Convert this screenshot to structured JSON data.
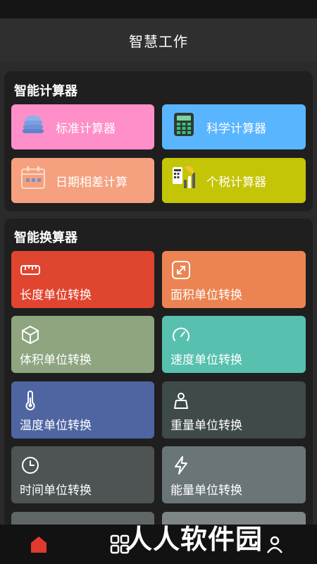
{
  "header": {
    "title": "智慧工作"
  },
  "calculators": {
    "title": "智能计算器",
    "items": [
      {
        "label": "标准计算器",
        "icon": "coin-stack-icon",
        "color": "#ff8fc8"
      },
      {
        "label": "科学计算器",
        "icon": "calculator-icon",
        "color": "#5ab5ff"
      },
      {
        "label": "日期相差计算",
        "icon": "calendar-icon",
        "color": "#f5a07f"
      },
      {
        "label": "个税计算器",
        "icon": "tax-chart-icon",
        "color": "#c4c507"
      }
    ]
  },
  "converters": {
    "title": "智能换算器",
    "items": [
      {
        "label": "长度单位转换",
        "icon": "ruler-icon",
        "color": "#e04530"
      },
      {
        "label": "面积单位转换",
        "icon": "expand-icon",
        "color": "#eb8452"
      },
      {
        "label": "体积单位转换",
        "icon": "cube-icon",
        "color": "#8ea57f"
      },
      {
        "label": "速度单位转换",
        "icon": "speedometer-icon",
        "color": "#57c0ae"
      },
      {
        "label": "温度单位转换",
        "icon": "thermometer-icon",
        "color": "#4e65a2"
      },
      {
        "label": "重量单位转换",
        "icon": "weight-icon",
        "color": "#3f4a4a"
      },
      {
        "label": "时间单位转换",
        "icon": "clock-icon",
        "color": "#4d5453"
      },
      {
        "label": "能量单位转换",
        "icon": "lightning-icon",
        "color": "#6a7577"
      }
    ]
  },
  "bottom_nav": {
    "items": [
      {
        "icon": "home-icon",
        "color": "#e03a2e"
      },
      {
        "icon": "grid-icon",
        "color": "#ffffff"
      },
      {
        "icon": "user-icon",
        "color": "#ffffff"
      }
    ]
  },
  "watermark": {
    "text": "人人软件园"
  }
}
